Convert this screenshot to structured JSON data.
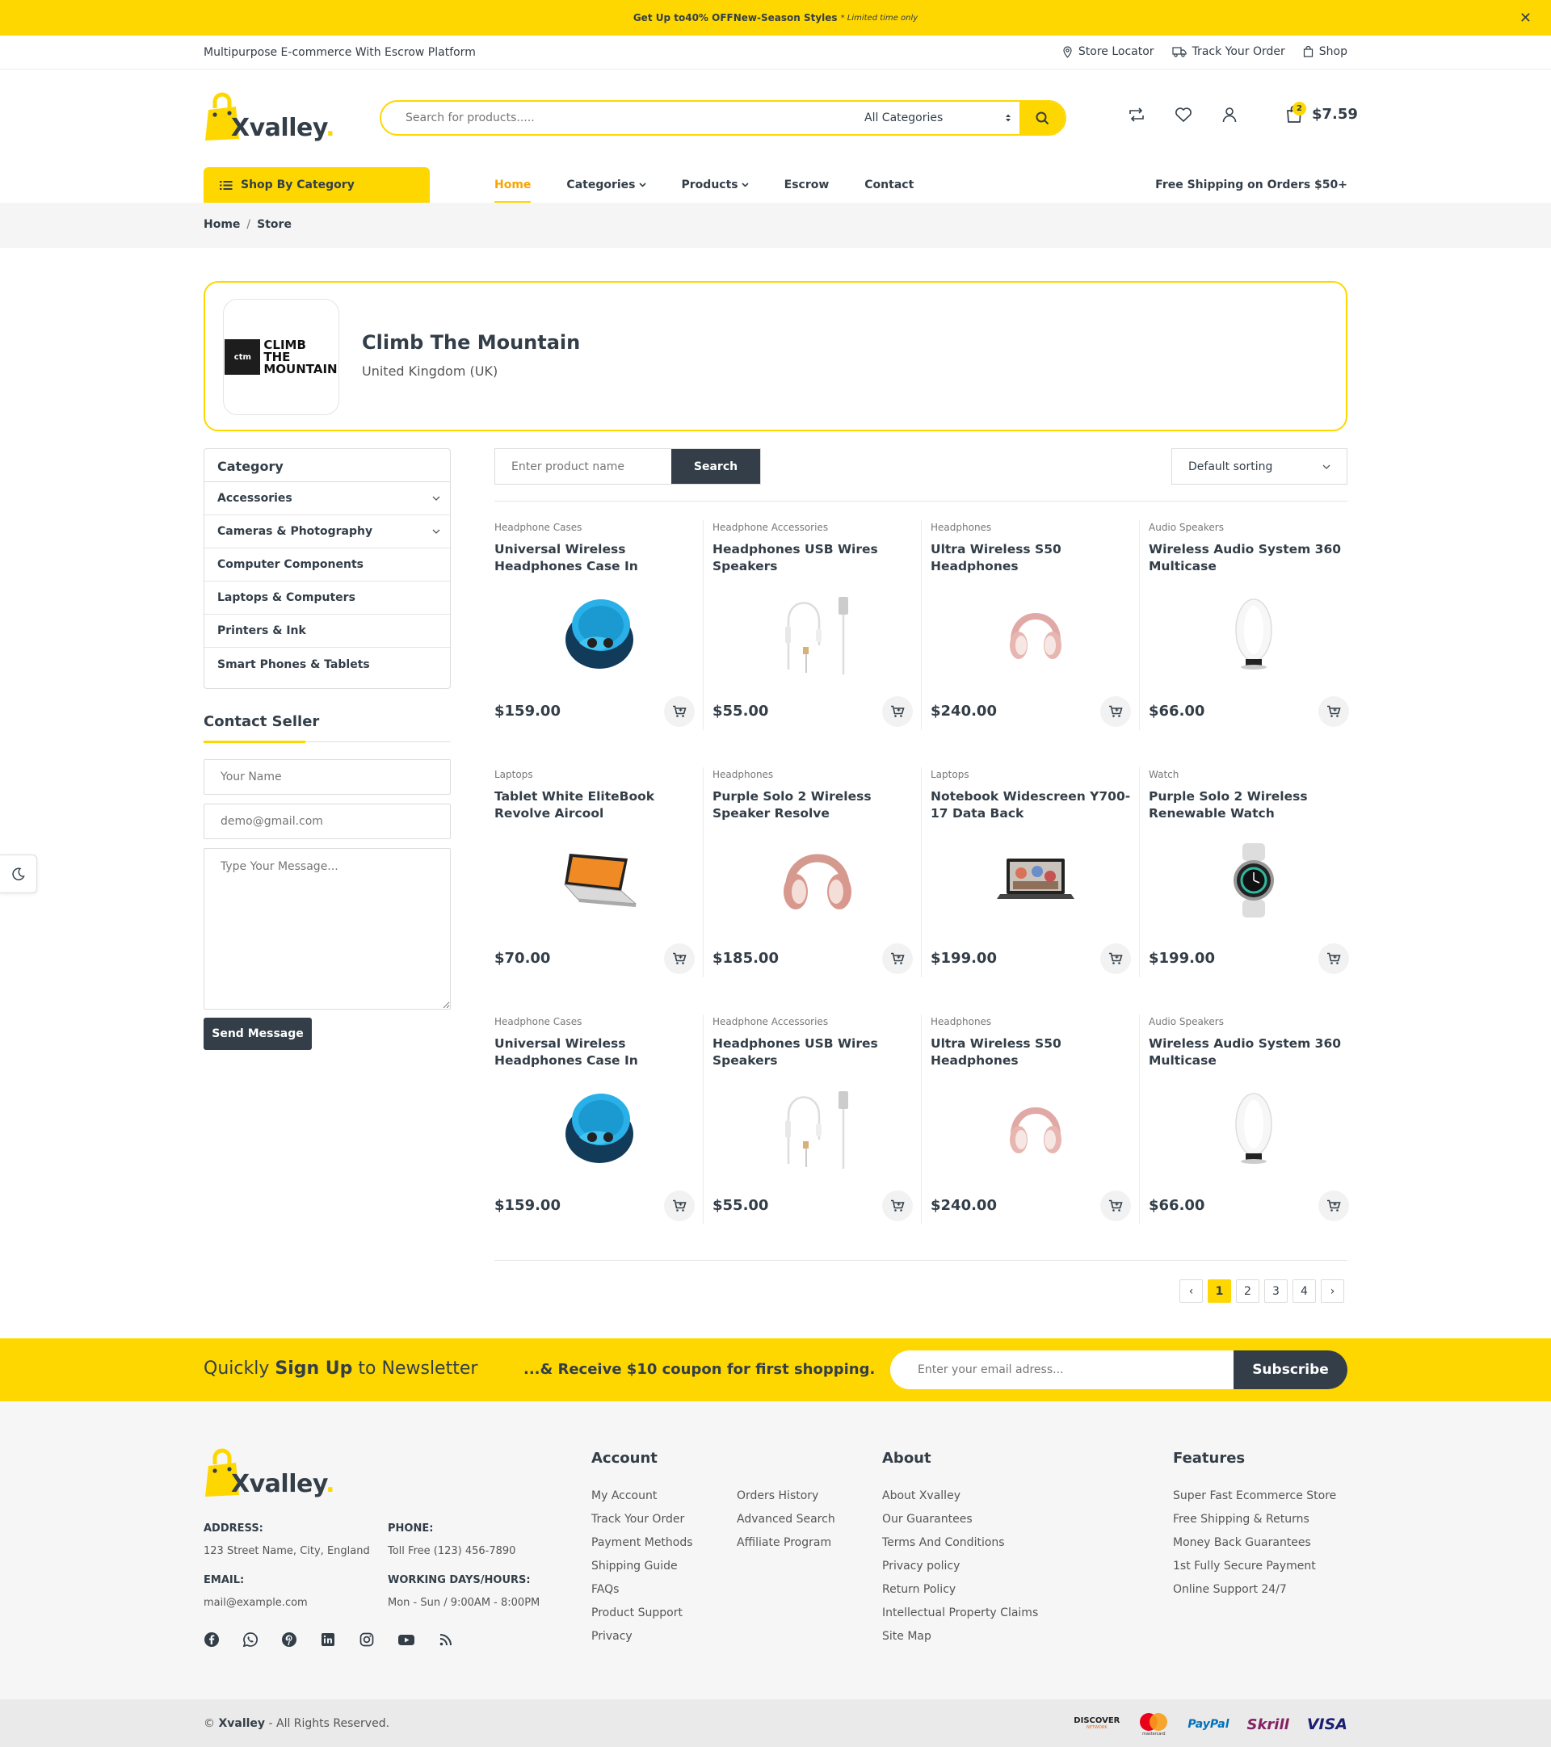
{
  "promo": {
    "prefix": "Get Up to ",
    "highlight": "40% OFF",
    "suffix": " New-Season Styles",
    "note": "* Limited time only",
    "close": "✕"
  },
  "topbar": {
    "tagline": "Multipurpose E-commerce With Escrow Platform",
    "links": [
      "Store Locator",
      "Track Your Order",
      "Shop"
    ]
  },
  "header": {
    "logo_word": "Xvalley",
    "logo_dot": ".",
    "search_placeholder": "Search for products.....",
    "category_select": "All Categories",
    "cart_count": "2",
    "cart_total": "$7.59"
  },
  "nav": {
    "shop_by_category": "Shop By Category",
    "items": [
      "Home",
      "Categories",
      "Products",
      "Escrow",
      "Contact"
    ],
    "active": "Home",
    "free_shipping_prefix": "Free Shipping on ",
    "free_shipping_bold": "Orders $50+"
  },
  "breadcrumb": [
    "Home",
    "Store"
  ],
  "store": {
    "logo_badge": "ctm",
    "logo_text": [
      "CLIMB",
      "THE",
      "MOUNTAIN"
    ],
    "name": "Climb The Mountain",
    "location": "United Kingdom (UK)"
  },
  "sidebar": {
    "category_title": "Category",
    "categories": [
      {
        "label": "Accessories",
        "expandable": true
      },
      {
        "label": "Cameras & Photography",
        "expandable": true
      },
      {
        "label": "Computer Components",
        "expandable": false
      },
      {
        "label": "Laptops & Computers",
        "expandable": false
      },
      {
        "label": "Printers & Ink",
        "expandable": false
      },
      {
        "label": "Smart Phones & Tablets",
        "expandable": false
      }
    ],
    "contact_title": "Contact Seller",
    "name_placeholder": "Your Name",
    "email_placeholder": "demo@gmail.com",
    "message_placeholder": "Type Your Message...",
    "send_label": "Send Message"
  },
  "toolbar": {
    "search_placeholder": "Enter product name",
    "search_button": "Search",
    "sorting": "Default sorting"
  },
  "products": [
    {
      "category": "Headphone Cases",
      "name": "Universal Wireless Headphones Case In",
      "price": "$159.00",
      "image": "case"
    },
    {
      "category": "Headphone Accessories",
      "name": "Headphones USB Wires Speakers",
      "price": "$55.00",
      "image": "wires"
    },
    {
      "category": "Headphones",
      "name": "Ultra Wireless S50 Headphones",
      "price": "$240.00",
      "image": "headphones-small"
    },
    {
      "category": "Audio Speakers",
      "name": "Wireless Audio System 360 Multicase",
      "price": "$66.00",
      "image": "speaker"
    },
    {
      "category": "Laptops",
      "name": "Tablet White EliteBook Revolve Aircool",
      "price": "$70.00",
      "image": "laptop-yoga"
    },
    {
      "category": "Headphones",
      "name": "Purple Solo 2 Wireless Speaker Resolve",
      "price": "$185.00",
      "image": "headphones-large"
    },
    {
      "category": "Laptops",
      "name": "Notebook Widescreen Y700-17 Data Back",
      "price": "$199.00",
      "image": "notebook"
    },
    {
      "category": "Watch",
      "name": "Purple Solo 2 Wireless Renewable Watch",
      "price": "$199.00",
      "image": "watch"
    },
    {
      "category": "Headphone Cases",
      "name": "Universal Wireless Headphones Case In",
      "price": "$159.00",
      "image": "case"
    },
    {
      "category": "Headphone Accessories",
      "name": "Headphones USB Wires Speakers",
      "price": "$55.00",
      "image": "wires"
    },
    {
      "category": "Headphones",
      "name": "Ultra Wireless S50 Headphones",
      "price": "$240.00",
      "image": "headphones-small"
    },
    {
      "category": "Audio Speakers",
      "name": "Wireless Audio System 360 Multicase",
      "price": "$66.00",
      "image": "speaker"
    }
  ],
  "pagination": {
    "prev": "‹",
    "pages": [
      "1",
      "2",
      "3",
      "4"
    ],
    "current": "1",
    "next": "›"
  },
  "newsletter": {
    "lead": "Quickly ",
    "bold": "Sign Up",
    "tail": " to Newsletter",
    "offer": "...& Receive $10 coupon for first shopping.",
    "email_placeholder": "Enter your email adress...",
    "subscribe": "Subscribe"
  },
  "footer": {
    "address_label": "ADDRESS:",
    "address": "123 Street Name, City, England",
    "phone_label": "PHONE:",
    "phone": "Toll Free (123) 456-7890",
    "email_label": "EMAIL:",
    "email": "mail@example.com",
    "hours_label": "WORKING DAYS/HOURS:",
    "hours": "Mon - Sun / 9:00AM - 8:00PM",
    "social": [
      "facebook-icon",
      "whatsapp-icon",
      "pinterest-icon",
      "linkedin-icon",
      "instagram-icon",
      "youtube-icon",
      "rss-icon"
    ],
    "account_title": "Account",
    "account_col1": [
      "My Account",
      "Track Your Order",
      "Payment Methods",
      "Shipping Guide",
      "FAQs",
      "Product Support",
      "Privacy"
    ],
    "account_col2": [
      "Orders History",
      "Advanced Search",
      "Affiliate Program"
    ],
    "about_title": "About",
    "about": [
      "About Xvalley",
      "Our Guarantees",
      "Terms And Conditions",
      "Privacy policy",
      "Return Policy",
      "Intellectual Property Claims",
      "Site Map"
    ],
    "features_title": "Features",
    "features": [
      "Super Fast Ecommerce Store",
      "Free Shipping & Returns",
      "Money Back Guarantees",
      "1st Fully Secure Payment",
      "Online Support 24/7"
    ],
    "copyright_symbol": "© ",
    "copyright_brand": "Xvalley",
    "copyright_rest": " - All Rights Reserved.",
    "payments": [
      "DISCOVER",
      "mastercard",
      "PayPal",
      "Skrill",
      "VISA"
    ],
    "payment_sub": "NETWORK"
  },
  "colors": {
    "accent": "#fed700",
    "dark": "#333e48",
    "active_nav": "#f6a600"
  }
}
